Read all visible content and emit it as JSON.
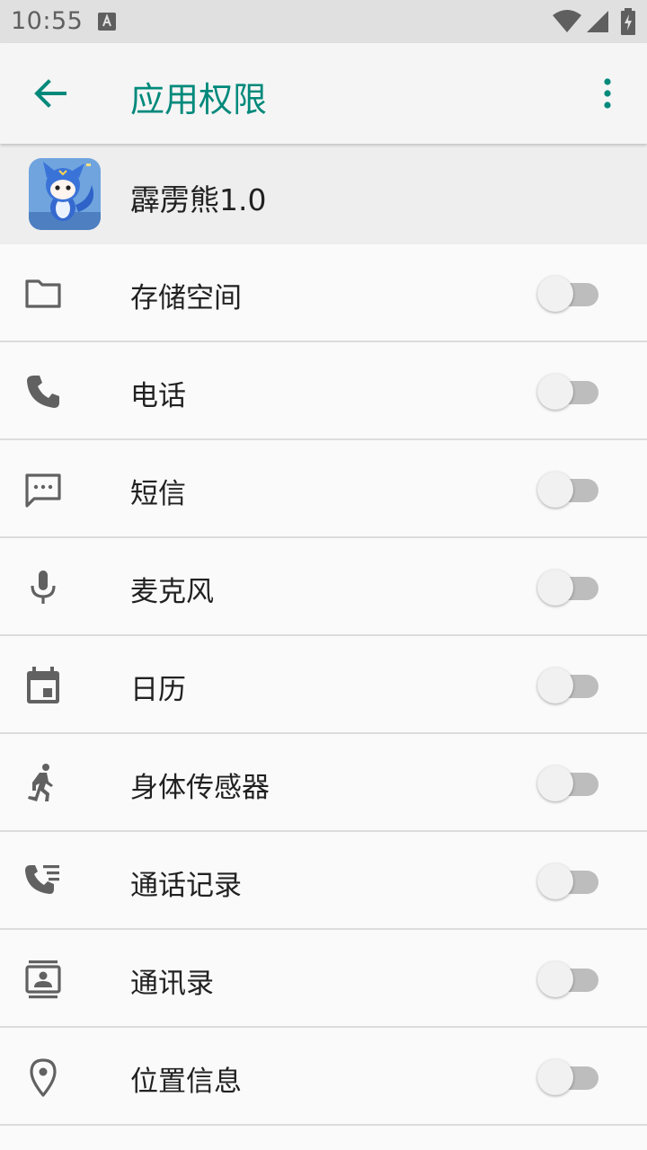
{
  "status_bar": {
    "time": "10:55",
    "notification_icon": "a-notification-icon",
    "icons": [
      "wifi-icon",
      "cell-signal-icon",
      "battery-charging-icon"
    ]
  },
  "app_bar": {
    "back_icon": "arrow-back-icon",
    "title": "应用权限",
    "menu_icon": "more-vert-icon",
    "accent_color": "#00897b"
  },
  "app": {
    "name": "霹雳熊1.0",
    "icon": "app-icon-blue-fox"
  },
  "permissions": [
    {
      "label": "存储空间",
      "icon": "folder-icon",
      "enabled": false
    },
    {
      "label": "电话",
      "icon": "phone-icon",
      "enabled": false
    },
    {
      "label": "短信",
      "icon": "sms-icon",
      "enabled": false
    },
    {
      "label": "麦克风",
      "icon": "mic-icon",
      "enabled": false
    },
    {
      "label": "日历",
      "icon": "calendar-icon",
      "enabled": false
    },
    {
      "label": "身体传感器",
      "icon": "body-sensor-icon",
      "enabled": false
    },
    {
      "label": "通话记录",
      "icon": "call-log-icon",
      "enabled": false
    },
    {
      "label": "通讯录",
      "icon": "contacts-icon",
      "enabled": false
    },
    {
      "label": "位置信息",
      "icon": "location-icon",
      "enabled": false
    }
  ]
}
